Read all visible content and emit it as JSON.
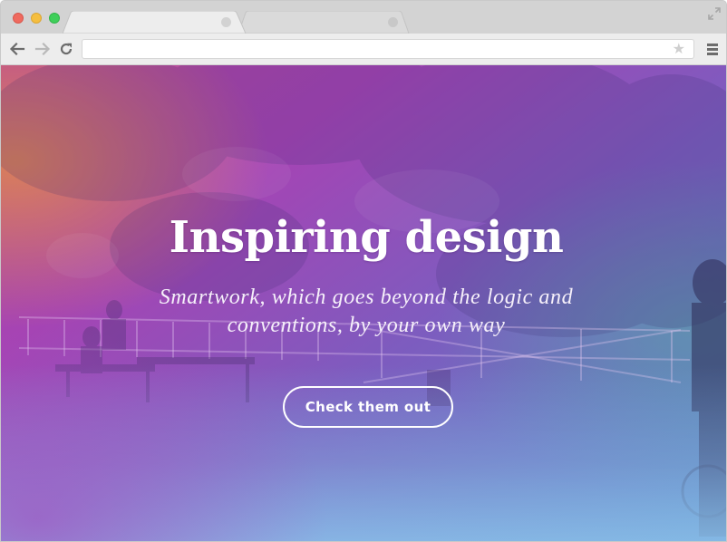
{
  "browser": {
    "tabs": [
      {
        "label": "",
        "active": true
      },
      {
        "label": "",
        "active": false
      }
    ],
    "address_bar": {
      "value": "",
      "placeholder": ""
    },
    "icons": {
      "back": "arrow-left-icon",
      "forward": "arrow-right-icon",
      "reload": "reload-icon",
      "bookmark": "star-icon",
      "menu": "hamburger-menu-icon",
      "fullscreen": "expand-arrows-icon"
    },
    "colors": {
      "close": "#ef6a5f",
      "minimize": "#f5be3f",
      "maximize": "#3fcf5a",
      "tabstrip": "#d3d3d3",
      "toolbar": "#ededed"
    }
  },
  "hero": {
    "title": "Inspiring design",
    "subtitle": "Smartwork, which goes beyond the logic and conventions, by your own way",
    "cta_label": "Check them out",
    "background": "park photo with purple-to-teal gradient overlay",
    "colors": {
      "gradient_magenta": "#a542b8",
      "gradient_purple": "#7a55bf",
      "gradient_teal": "#6aaee0",
      "gradient_orange": "#d27a4a",
      "text": "#ffffff"
    }
  }
}
